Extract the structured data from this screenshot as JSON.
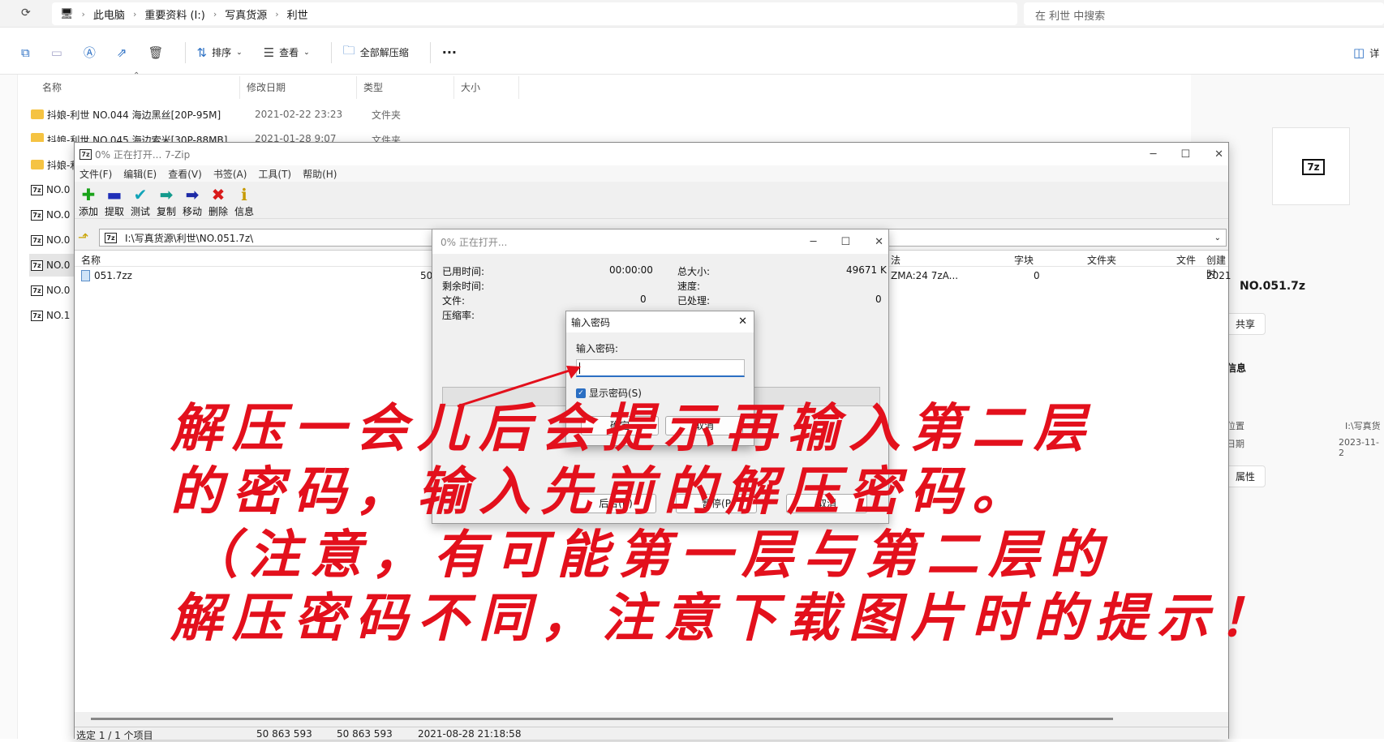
{
  "explorer": {
    "breadcrumbs": [
      "此电脑",
      "重要资料 (I:)",
      "写真货源",
      "利世"
    ],
    "search_placeholder": "在 利世 中搜索",
    "commands": {
      "sort": "排序",
      "view": "查看",
      "extract_all": "全部解压缩",
      "details": "详"
    },
    "columns": {
      "name": "名称",
      "modified": "修改日期",
      "type": "类型",
      "size": "大小"
    },
    "rows": [
      {
        "name": "抖娘-利世 NO.044 海边黑丝[20P-95M]",
        "date": "2021-02-22 23:23",
        "type": "文件夹"
      },
      {
        "name": "抖娘-利世 NO.045 海边索米[30P-88MB]",
        "date": "2021-01-28 9:07",
        "type": "文件夹"
      },
      {
        "name": "抖娘-利",
        "date": "",
        "type": ""
      },
      {
        "name": "NO.0",
        "date": "",
        "type": ""
      },
      {
        "name": "NO.0",
        "date": "",
        "type": ""
      },
      {
        "name": "NO.0",
        "date": "",
        "type": ""
      },
      {
        "name": "NO.0",
        "date": "",
        "type": ""
      },
      {
        "name": "NO.0",
        "date": "",
        "type": ""
      },
      {
        "name": "NO.1",
        "date": "",
        "type": ""
      }
    ],
    "details_pane": {
      "file_name": "NO.051.7z",
      "share": "共享",
      "info": "信息",
      "location_label": "位置",
      "location_value": "I:\\写真货",
      "date_label": "日期",
      "date_value": "2023-11-2",
      "properties": "属性"
    }
  },
  "zip": {
    "title": "0% 正在打开... 7-Zip",
    "menu": [
      "文件(F)",
      "编辑(E)",
      "查看(V)",
      "书签(A)",
      "工具(T)",
      "帮助(H)"
    ],
    "toolbar": [
      {
        "label": "添加",
        "glyph": "✚",
        "color": "#1aa31a"
      },
      {
        "label": "提取",
        "glyph": "▬",
        "color": "#1f2fb8"
      },
      {
        "label": "测试",
        "glyph": "✔",
        "color": "#12a4b8"
      },
      {
        "label": "复制",
        "glyph": "➡",
        "color": "#129a8c"
      },
      {
        "label": "移动",
        "glyph": "➡",
        "color": "#1d2aa6"
      },
      {
        "label": "删除",
        "glyph": "✖",
        "color": "#d91a1a"
      },
      {
        "label": "信息",
        "glyph": "ℹ",
        "color": "#c79a00"
      }
    ],
    "path": "I:\\写真货源\\利世\\NO.051.7z\\",
    "list_headers": {
      "name": "名称",
      "method": "法",
      "block": "字块",
      "folder": "文件夹",
      "file": "文件",
      "created": "创建时"
    },
    "list_row": {
      "name": "051.7zz",
      "size": "50 8",
      "method": "ZMA:24 7zA...",
      "block": "0",
      "created": "2021"
    },
    "status": {
      "selected": "选定 1 / 1 个项目",
      "size1": "50 863 593",
      "size2": "50 863 593",
      "date": "2021-08-28 21:18:58"
    }
  },
  "progress": {
    "title": "0% 正在打开...",
    "elapsed_label": "已用时间:",
    "elapsed_value": "00:00:00",
    "remaining_label": "剩余时间:",
    "files_label": "文件:",
    "files_value": "0",
    "ratio_label": "压缩率:",
    "total_label": "总大小:",
    "total_value": "49671 K",
    "speed_label": "速度:",
    "processed_label": "已处理:",
    "processed_value": "0",
    "background": "后台(B)",
    "pause": "暂停(P",
    "cancel": "取消"
  },
  "password": {
    "title": "输入密码",
    "prompt": "输入密码:",
    "show_password": "显示密码(S)",
    "ok": "确定",
    "cancel": "取消"
  },
  "annotation": {
    "lines": [
      "解压一会儿后会提示再输入第二层",
      "的密码，输入先前的解压密码。",
      "（注意，有可能第一层与第二层的",
      "解压密码不同，注意下载图片时的提示！"
    ],
    "color": "#e3101c"
  }
}
